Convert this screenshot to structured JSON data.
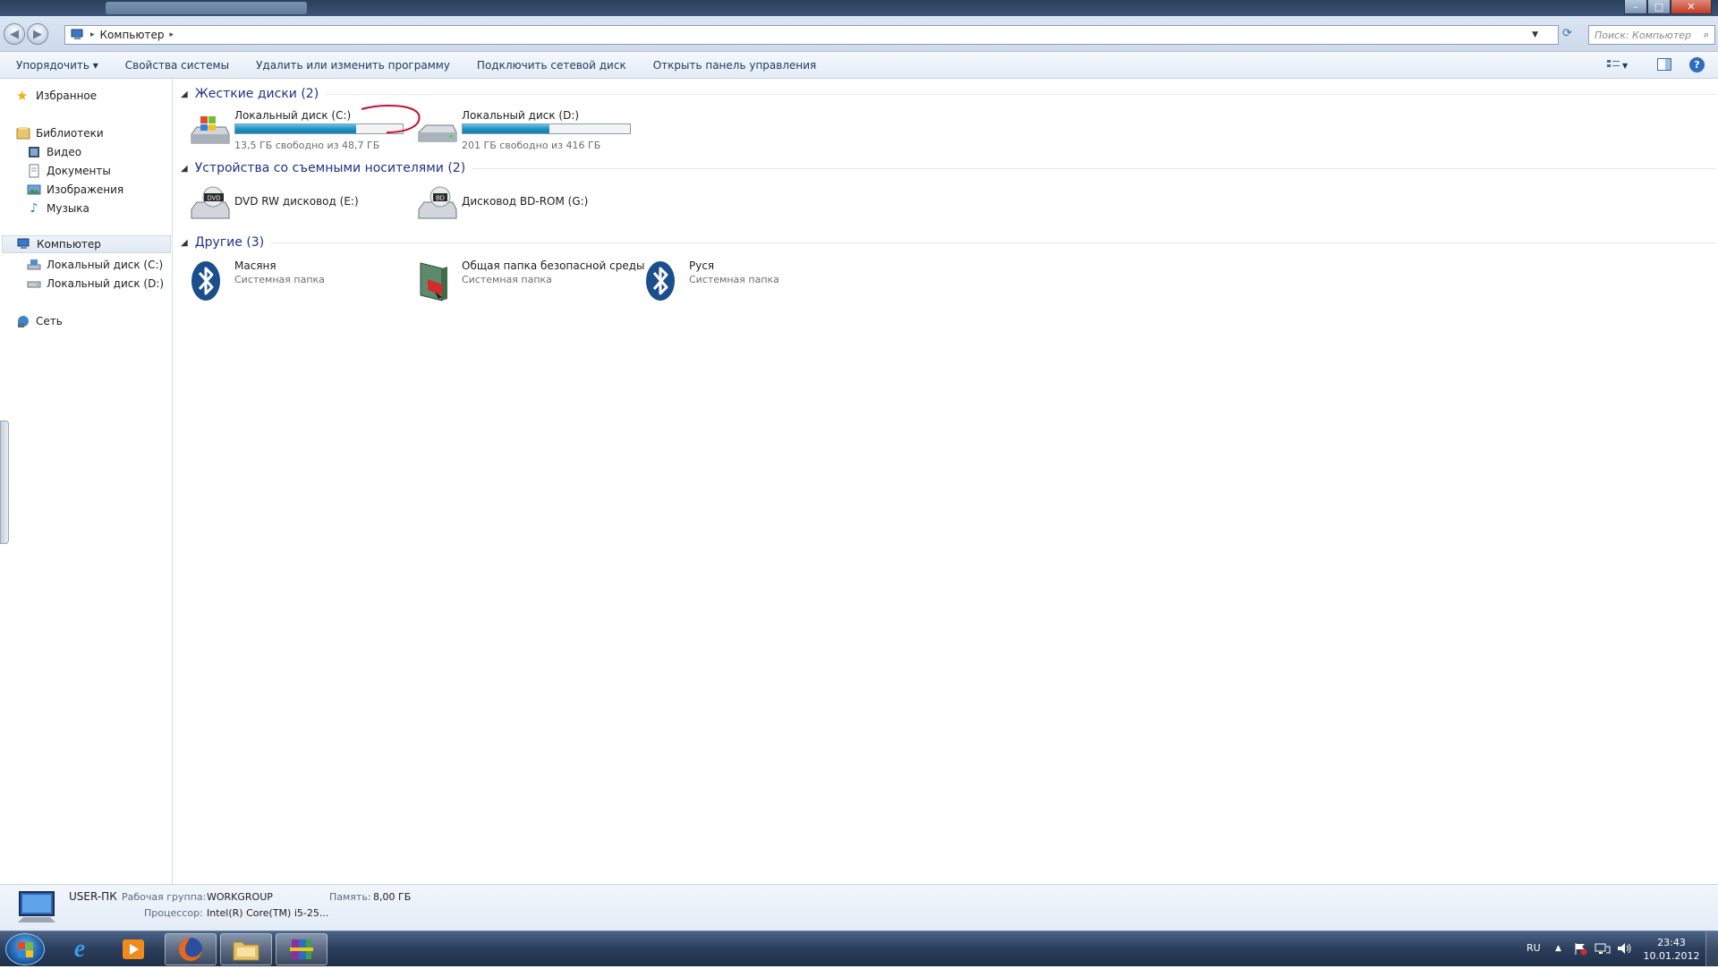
{
  "window": {
    "title": "Компьютер",
    "minimize": "–",
    "maximize": "□",
    "close": "✕"
  },
  "address": {
    "path": [
      "Компьютер"
    ],
    "search_placeholder": "Поиск: Компьютер"
  },
  "toolbar": {
    "items": [
      "Упорядочить ▾",
      "Свойства системы",
      "Удалить или изменить программу",
      "Подключить сетевой диск",
      "Открыть панель управления"
    ]
  },
  "sidebar": {
    "favorites": "Избранное",
    "libraries": "Библиотеки",
    "library_items": [
      "Видео",
      "Документы",
      "Изображения",
      "Музыка"
    ],
    "computer": "Компьютер",
    "computer_items": [
      "Локальный диск (C:)",
      "Локальный диск (D:)"
    ],
    "network": "Сеть"
  },
  "groups": {
    "hard_disks": {
      "header": "Жесткие диски (2)",
      "items": [
        {
          "name": "Локальный диск (C:)",
          "info": "13,5 ГБ свободно из 48,7 ГБ",
          "used_fraction": 0.72
        },
        {
          "name": "Локальный диск (D:)",
          "info": "201 ГБ свободно из 416 ГБ",
          "used_fraction": 0.52
        }
      ]
    },
    "removable": {
      "header": "Устройства со съемными носителями (2)",
      "items": [
        {
          "name": "DVD RW дисковод (E:)",
          "badge": "DVD"
        },
        {
          "name": "Дисковод BD-ROM (G:)",
          "badge": "BD"
        }
      ]
    },
    "other": {
      "header": "Другие (3)",
      "items": [
        {
          "name": "Масяня",
          "info": "Системная папка"
        },
        {
          "name": "Общая папка безопасной среды",
          "info": "Системная папка"
        },
        {
          "name": "Руся",
          "info": "Системная папка"
        }
      ]
    }
  },
  "details": {
    "computer_name": "USER-ПК",
    "workgroup_label": "Рабочая группа:",
    "workgroup_value": "WORKGROUP",
    "memory_label": "Память:",
    "memory_value": "8,00 ГБ",
    "cpu_label": "Процессор:",
    "cpu_value": "Intel(R) Core(TM) i5-25..."
  },
  "taskbar": {
    "language": "RU",
    "time": "23:43",
    "date": "10.01.2012"
  },
  "colors": {
    "accent_text": "#1e3287",
    "bar_fill": "#1d8fc0",
    "bluetooth": "#1a4e8c"
  }
}
